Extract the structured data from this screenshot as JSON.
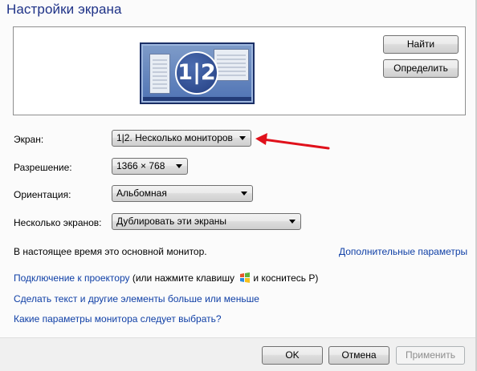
{
  "window": {
    "title": "Настройки экрана"
  },
  "preview": {
    "monitor_label": "1|2"
  },
  "buttons": {
    "find": "Найти",
    "identify": "Определить",
    "ok": "OK",
    "cancel": "Отмена",
    "apply": "Применить"
  },
  "fields": {
    "display": {
      "label": "Экран:",
      "value": "1|2. Несколько мониторов"
    },
    "resolution": {
      "label": "Разрешение:",
      "value": "1366 × 768"
    },
    "orientation": {
      "label": "Ориентация:",
      "value": "Альбомная"
    },
    "multiple": {
      "label": "Несколько экранов:",
      "value": "Дублировать эти экраны"
    }
  },
  "status_text": "В настоящее время это основной монитор.",
  "links": {
    "advanced": "Дополнительные параметры",
    "projector": "Подключение к проектору",
    "projector_suffix_before": " (или нажмите клавишу",
    "projector_suffix_after": "и коснитесь P)",
    "text_size": "Сделать текст и другие элементы больше или меньше",
    "which_settings": "Какие параметры монитора следует выбрать?"
  },
  "icons": {
    "windows_key": "windows-logo-icon",
    "annotation": "red-arrow-icon"
  },
  "colors": {
    "title": "#1e3287",
    "link": "#0f3fa6",
    "annotation": "#e0111b"
  }
}
